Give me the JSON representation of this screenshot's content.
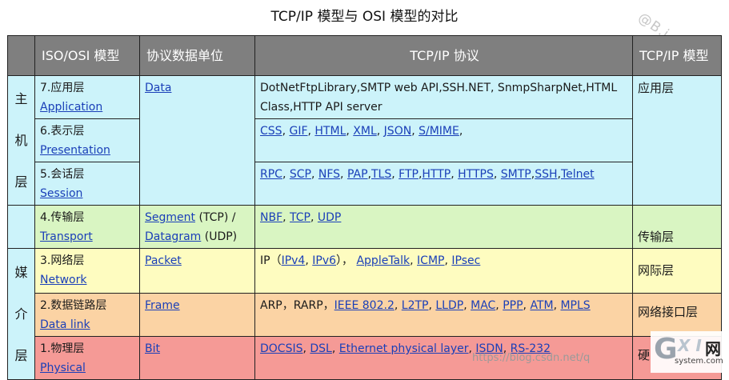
{
  "title": "TCP/IP 模型与 OSI 模型的对比",
  "watermark_corner": "@B.i",
  "watermark_url": "https://blog.csdn.net/q",
  "logo": {
    "g": "G",
    "xi": "X I",
    "wang": "网",
    "site": "system.com"
  },
  "headers": [
    "ISO/OSI 模型",
    "协议数据单位",
    "TCP/IP 协议",
    "TCP/IP 模型"
  ],
  "groups": {
    "host": [
      "主",
      "机",
      "层"
    ],
    "media": [
      "媒",
      "介",
      "层"
    ]
  },
  "layers": {
    "application": {
      "num": "7.应用层",
      "name": "Application",
      "protocols": [
        "DotNetFtpLibrary,SMTP web API,SSH.NET, SnmpSharpNet,HTML",
        "Class,HTTP API server"
      ]
    },
    "presentation": {
      "num": "6.表示层",
      "name": "Presentation",
      "protocols": [
        "CSS",
        "GIF",
        "HTML",
        "XML",
        "JSON",
        "S/MIME"
      ]
    },
    "session": {
      "num": "5.会话层",
      "name": "Session",
      "protocols": [
        "RPC",
        "SCP",
        "NFS",
        "PAP",
        "TLS",
        "FTP",
        "HTTP",
        "HTTPS",
        "SMTP",
        "SSH",
        "Telnet"
      ]
    },
    "transport": {
      "num": "4.传输层",
      "name": "Transport",
      "protocols": [
        "NBF",
        "TCP",
        "UDP"
      ]
    },
    "network": {
      "num": "3.网络层",
      "name": "Network",
      "protocols": [
        "IPv4",
        "IPv6",
        "AppleTalk",
        "ICMP",
        "IPsec"
      ],
      "prefix": "IP（",
      "mid": "）， "
    },
    "datalink": {
      "num": "2.数据链路层",
      "name": "Data link",
      "protocols": [
        "IEEE 802.2",
        "L2TP",
        "LLDP",
        "MAC",
        "PPP",
        "ATM",
        "MPLS"
      ],
      "prefix": "ARP，RARP，"
    },
    "physical": {
      "num": "1.物理层",
      "name": "Physical",
      "protocols": [
        "DOCSIS",
        "DSL",
        "Ethernet physical layer",
        "ISDN",
        "RS-232"
      ]
    }
  },
  "pdu": {
    "data": "Data",
    "segment": "Segment",
    "segment_note": " (TCP) /",
    "datagram": "Datagram",
    "datagram_note": " (UDP)",
    "packet": "Packet",
    "frame": "Frame",
    "bit": "Bit"
  },
  "tcpip_model": {
    "application": "应用层",
    "transport": "传输层",
    "internet": "网际层",
    "link": "网络接口层",
    "hardware": "硬"
  }
}
